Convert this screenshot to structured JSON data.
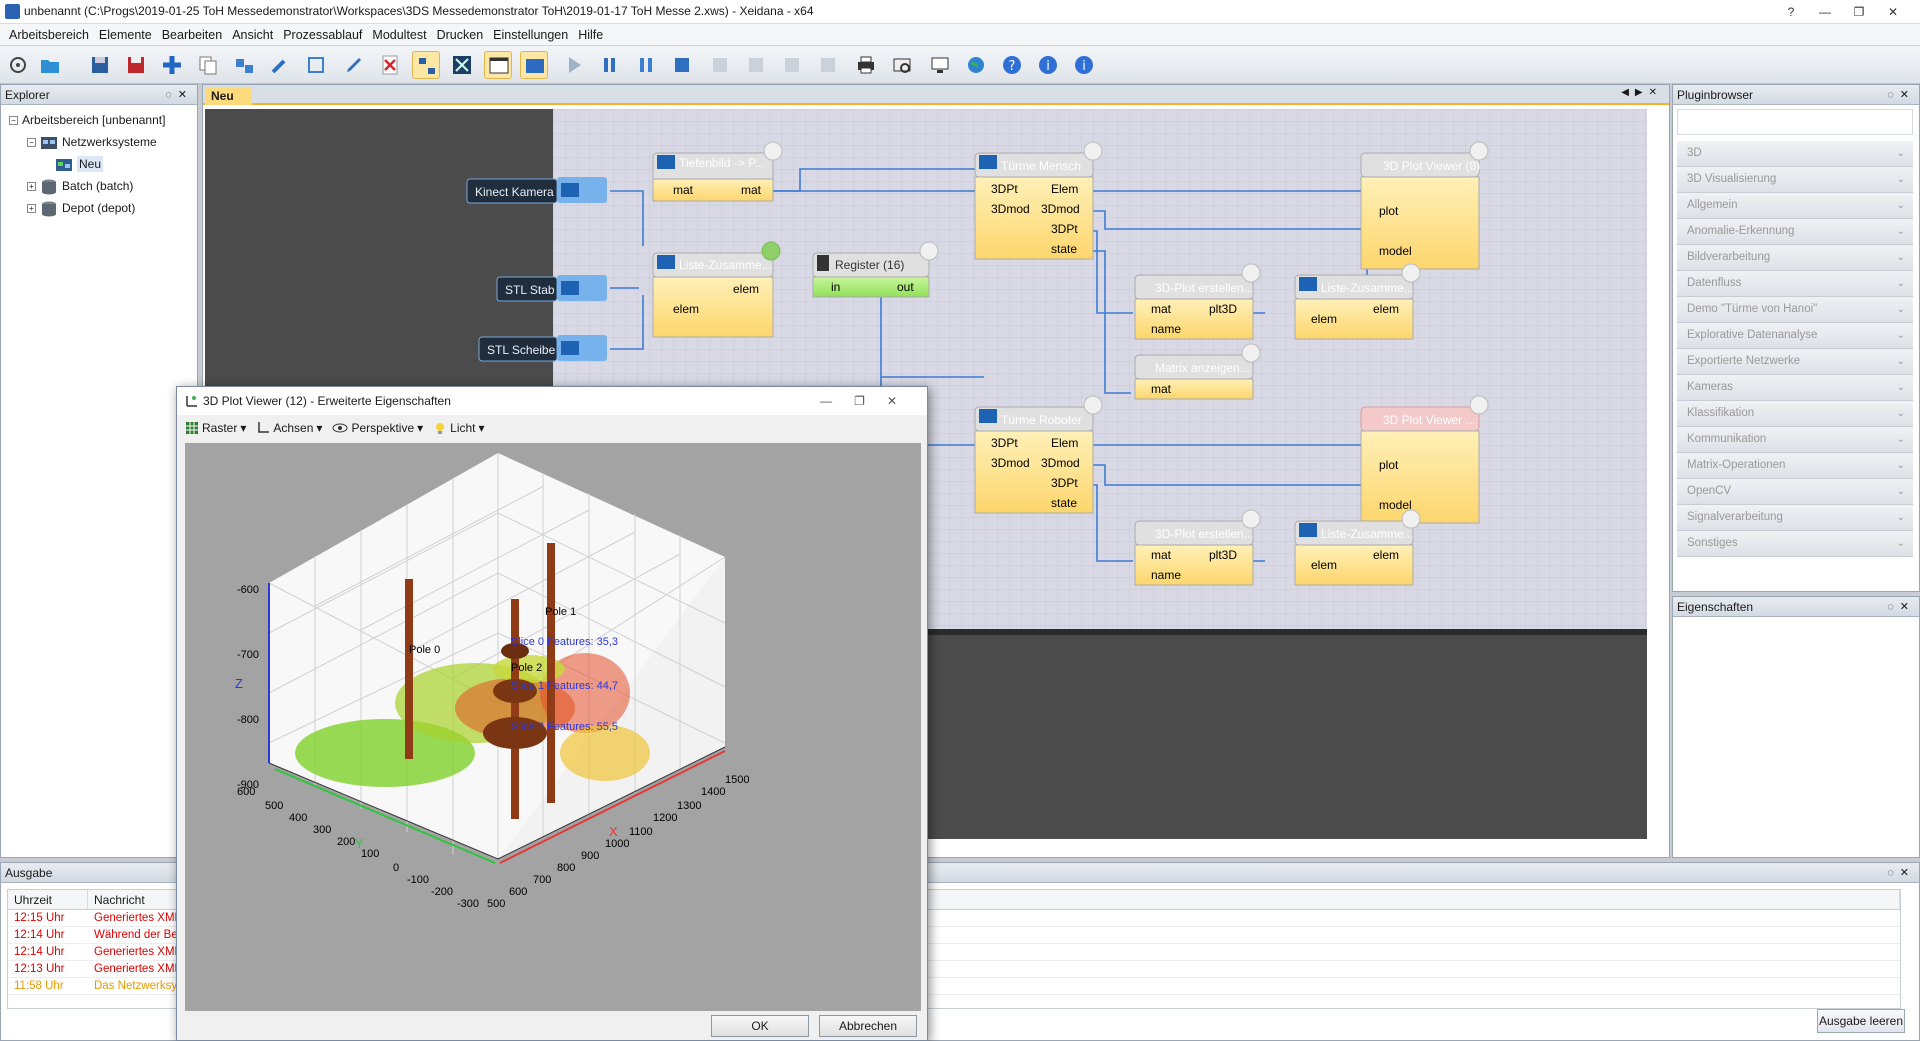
{
  "window": {
    "title": "unbenannt (C:\\Progs\\2019-01-25 ToH Messedemonstrator\\Workspaces\\3DS Messedemonstrator ToH\\2019-01-17 ToH Messe 2.xws) - Xeidana - x64"
  },
  "menu": [
    "Arbeitsbereich",
    "Elemente",
    "Bearbeiten",
    "Ansicht",
    "Prozessablauf",
    "Modultest",
    "Drucken",
    "Einstellungen",
    "Hilfe"
  ],
  "explorer": {
    "title": "Explorer",
    "root": "Arbeitsbereich [unbenannt]",
    "netz": "Netzwerksysteme",
    "neu": "Neu",
    "batch": "Batch (batch)",
    "depot": "Depot (depot)"
  },
  "editor": {
    "tab": "Neu",
    "inputs": {
      "kinect": "Kinect Kamera",
      "stab": "STL Stab",
      "scheibe": "STL Scheibe"
    },
    "nodes": {
      "tiefen": "Tiefenbild -> P...",
      "liste1": "Liste-Zusamme...",
      "register": "Register (16)",
      "tuerme_mensch": "Türme Mensch",
      "tuerme_roboter": "Türme Roboter",
      "plot8": "3D Plot Viewer (8)",
      "plot12": "3D Plot Viewer ...",
      "erstellen1": "3D-Plot erstellen...",
      "erstellen2": "3D-Plot erstellen...",
      "liste2": "Liste-Zusamme...",
      "liste3": "Liste-Zusamme...",
      "matrix": "Matrix anzeigen..."
    },
    "ports": {
      "mat": "mat",
      "elem": "elem",
      "in": "in",
      "out": "out",
      "pt": "3DPt",
      "elemU": "Elem",
      "mod": "3Dmod",
      "state": "state",
      "plot": "plot",
      "model": "model",
      "name": "name",
      "plt": "plt3D"
    }
  },
  "plugins": {
    "title": "Pluginbrowser",
    "items": [
      "3D",
      "3D Visualisierung",
      "Allgemein",
      "Anomalie-Erkennung",
      "Bildverarbeitung",
      "Datenfluss",
      "Demo \"Türme von Hanoi\"",
      "Explorative Datenanalyse",
      "Exportierte Netzwerke",
      "Kameras",
      "Klassifikation",
      "Kommunikation",
      "Matrix-Operationen",
      "OpenCV",
      "Signalverarbeitung",
      "Sonstiges"
    ]
  },
  "properties": {
    "title": "Eigenschaften"
  },
  "output": {
    "title": "Ausgabe",
    "col_time": "Uhrzeit",
    "col_msg": "Nachricht",
    "rows": [
      {
        "time": "12:15 Uhr",
        "msg": "Generiertes XML i",
        "color": "#e00000"
      },
      {
        "time": "12:14 Uhr",
        "msg": "Während der Bere",
        "color": "#e00000"
      },
      {
        "time": "12:14 Uhr",
        "msg": "Generiertes XML i",
        "color": "#e00000"
      },
      {
        "time": "12:13 Uhr",
        "msg": "Generiertes XML i",
        "color": "#e00000"
      },
      {
        "time": "11:58 Uhr",
        "msg": "Das Netzwerksyst",
        "color": "#e89a00"
      }
    ],
    "clear": "Ausgabe leeren"
  },
  "dialog": {
    "title": "3D Plot Viewer (12) - Erweiterte Eigenschaften",
    "tools": {
      "raster": "Raster",
      "achsen": "Achsen",
      "perspektive": "Perspektive",
      "licht": "Licht"
    },
    "ok": "OK",
    "cancel": "Abbrechen",
    "plot": {
      "zlabel": "Z",
      "xlabel": "X",
      "ylabel": "Y",
      "zticks": [
        "-600",
        "-700",
        "-800",
        "-900"
      ],
      "xticks": [
        "500",
        "600",
        "700",
        "800",
        "900",
        "1000",
        "1100",
        "1200",
        "1300",
        "1400",
        "1500"
      ],
      "yticks": [
        "600",
        "500",
        "400",
        "300",
        "200",
        "100",
        "0",
        "-100",
        "-200",
        "-300"
      ],
      "pole0": "Pole 0",
      "pole1": "Pole 1",
      "pole2": "Pole 2",
      "slice0": "Slice 0 Features: 35,3",
      "slice1": "Slice 1 Features: 44,7",
      "slice2": "Slice 2 Features: 55,5"
    }
  },
  "colors": {
    "accent": "#f6b12b",
    "node": "#fde18a",
    "link": "#3d7bd1"
  }
}
